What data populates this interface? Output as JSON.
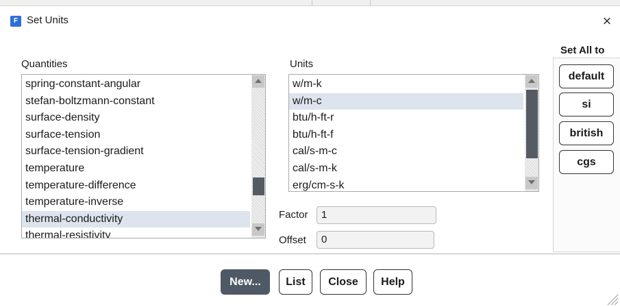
{
  "dialog": {
    "title": "Set Units",
    "app_icon": "app-icon",
    "close_glyph": "×"
  },
  "quantities": {
    "label": "Quantities",
    "items": [
      "spring-constant-angular",
      "stefan-boltzmann-constant",
      "surface-density",
      "surface-tension",
      "surface-tension-gradient",
      "temperature",
      "temperature-difference",
      "temperature-inverse",
      "thermal-conductivity",
      "thermal-resistivity"
    ],
    "selected": "thermal-conductivity"
  },
  "units": {
    "label": "Units",
    "items": [
      "w/m-k",
      "w/m-c",
      "btu/h-ft-r",
      "btu/h-ft-f",
      "cal/s-m-c",
      "cal/s-m-k",
      "erg/cm-s-k"
    ],
    "selected": "w/m-c"
  },
  "factor": {
    "label": "Factor",
    "value": "1"
  },
  "offset": {
    "label": "Offset",
    "value": "0"
  },
  "set_all": {
    "title": "Set All to",
    "buttons": [
      "default",
      "si",
      "british",
      "cgs"
    ]
  },
  "footer": {
    "new_label": "New...",
    "list_label": "List",
    "close_label": "Close",
    "help_label": "Help"
  },
  "colors": {
    "selection": "#dde4ee",
    "primary_button": "#4f5965",
    "scroll_thumb": "#555b63",
    "app_icon": "#2e6fd8"
  }
}
